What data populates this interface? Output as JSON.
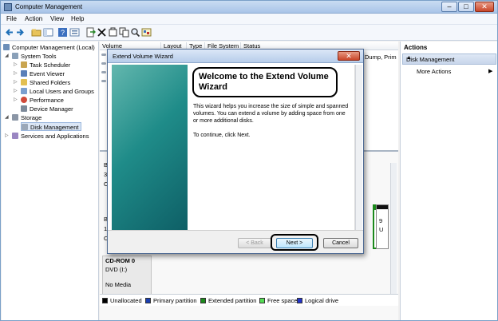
{
  "window": {
    "title": "Computer Management",
    "min_glyph": "–",
    "max_glyph": "□",
    "close_glyph": "✕"
  },
  "menu": [
    "File",
    "Action",
    "View",
    "Help"
  ],
  "toolbar_icons": [
    "back-icon",
    "forward-icon",
    "up-folder-icon",
    "console-tree-icon",
    "help-icon",
    "properties-icon",
    "export-icon",
    "delete-icon",
    "cut-icon",
    "copy-icon",
    "search-icon",
    "zoom-icon"
  ],
  "tree": {
    "root": "Computer Management (Local)",
    "system_tools": "System Tools",
    "task_scheduler": "Task Scheduler",
    "event_viewer": "Event Viewer",
    "shared_folders": "Shared Folders",
    "local_users": "Local Users and Groups",
    "performance": "Performance",
    "device_manager": "Device Manager",
    "storage": "Storage",
    "disk_management": "Disk Management",
    "services": "Services and Applications"
  },
  "columns": [
    "Volume",
    "Layout",
    "Type",
    "File System",
    "Status"
  ],
  "status_tail": "Dump, Prim",
  "disks": {
    "cdrom_name": "CD-ROM 0",
    "cdrom_drive": "DVD (I:)",
    "cdrom_media": "No Media",
    "row1_letters": [
      "B",
      "3",
      "O"
    ],
    "row2_letters": [
      "B",
      "1",
      "O"
    ],
    "partial": [
      "9",
      "U"
    ]
  },
  "legend": {
    "unallocated": "Unallocated",
    "primary": "Primary partition",
    "extended": "Extended partition",
    "free": "Free space",
    "logical": "Logical drive",
    "colors": {
      "unallocated": "#000000",
      "primary": "#1a3eb0",
      "extended": "#1c8a1c",
      "free": "#55dd55",
      "logical": "#2233cc"
    }
  },
  "actions": {
    "header": "Actions",
    "selected": "Disk Management",
    "more": "More Actions",
    "more_arrow": "▶"
  },
  "wizard": {
    "title": "Extend Volume Wizard",
    "heading": "Welcome to the Extend Volume Wizard",
    "body": "This wizard helps you increase the size of simple and spanned volumes. You can extend a volume  by adding space from one or more additional disks.",
    "continue_text": "To continue, click Next.",
    "back": "< Back",
    "next": "Next >",
    "cancel": "Cancel",
    "close_glyph": "✕"
  }
}
